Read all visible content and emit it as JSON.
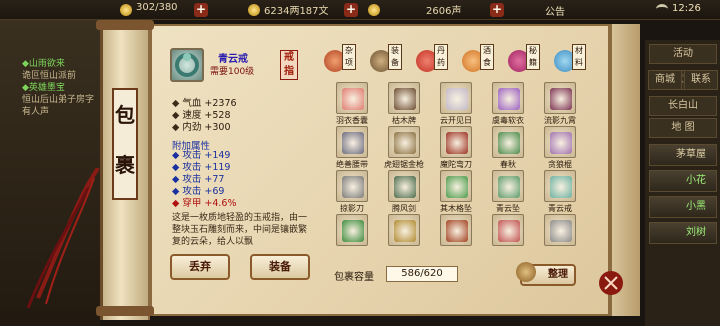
{
  "topbar": {
    "energy": "302/380",
    "money": "6234两187文",
    "prestige": "2606声",
    "notice": "公告",
    "time": "12:26"
  },
  "quests": [
    {
      "title": "◆山雨欲来",
      "desc": "诡叵恒山派前"
    },
    {
      "title": "◆英雄墨宝",
      "desc": "恒山后山弟子房字有人声"
    }
  ],
  "bag_label": [
    "包",
    "裹"
  ],
  "item": {
    "name": "青云戒",
    "requirement": "需要100级",
    "forge": "戒指",
    "stats": [
      {
        "label": "气血",
        "value": "+2376"
      },
      {
        "label": "速度",
        "value": "+528"
      },
      {
        "label": "内劲",
        "value": "+300"
      }
    ],
    "attach_title": "附加属性",
    "extra": [
      {
        "label": "攻击",
        "value": "+149"
      },
      {
        "label": "攻击",
        "value": "+119"
      },
      {
        "label": "攻击",
        "value": "+77"
      },
      {
        "label": "攻击",
        "value": "+69"
      },
      {
        "label": "穿甲",
        "value": "+4.6%"
      }
    ],
    "description": "这是一枚质地轻盈的玉戒指，由一整块玉石雕刻而来，中间是镶嵌繁复的云朵，给人以飘"
  },
  "actions": {
    "discard": "丢弃",
    "equip": "装备"
  },
  "tabs": [
    {
      "label": "杂项",
      "color": "#b04020"
    },
    {
      "label": "装备",
      "color": "#6a5030"
    },
    {
      "label": "丹药",
      "color": "#c03020"
    },
    {
      "label": "酒食",
      "color": "#d07020"
    },
    {
      "label": "秘籍",
      "color": "#a02060"
    },
    {
      "label": "材料",
      "color": "#3a8ac0"
    }
  ],
  "items": [
    {
      "name": "羽衣香囊",
      "color": "#e07a70"
    },
    {
      "name": "枯木牌",
      "color": "#6a4a30"
    },
    {
      "name": "云开见日",
      "color": "#c0b8c8"
    },
    {
      "name": "虞毒软衣",
      "color": "#9a60c0"
    },
    {
      "name": "流影九霄",
      "color": "#7a3050"
    },
    {
      "name": "绝善腰带",
      "color": "#6a6a80"
    },
    {
      "name": "虎翅锯金枪",
      "color": "#8a7040"
    },
    {
      "name": "魔陀弯刀",
      "color": "#9a3020"
    },
    {
      "name": "春秋",
      "color": "#4a8a4a"
    },
    {
      "name": "贪狼棍",
      "color": "#a070b0"
    },
    {
      "name": "掠影刀",
      "color": "#7a7a7a"
    },
    {
      "name": "腾风剑",
      "color": "#4a6a4a"
    },
    {
      "name": "其木格坠",
      "color": "#4a9a4a"
    },
    {
      "name": "青云坠",
      "color": "#5a9a6a"
    },
    {
      "name": "青云戒",
      "color": "#6ab0a0"
    },
    {
      "name": "",
      "color": "#3a8a3a"
    },
    {
      "name": "",
      "color": "#b08a30"
    },
    {
      "name": "",
      "color": "#a04020"
    },
    {
      "name": "",
      "color": "#c05050"
    },
    {
      "name": "",
      "color": "#8a8a8a"
    }
  ],
  "capacity": {
    "label": "包裹容量",
    "value": "586/620"
  },
  "tidy": "整理",
  "right_panel": {
    "buttons": [
      "活动",
      "藏宝",
      "商城",
      "联系"
    ],
    "location": "长白山 (1534)",
    "sub": "地  图",
    "list": [
      "茅草屋",
      "小花",
      "小黑",
      "刘树"
    ]
  },
  "colors": {
    "blue_text": "#1a30a0",
    "red_text": "#b01010",
    "green_quest": "#7cd65a"
  }
}
